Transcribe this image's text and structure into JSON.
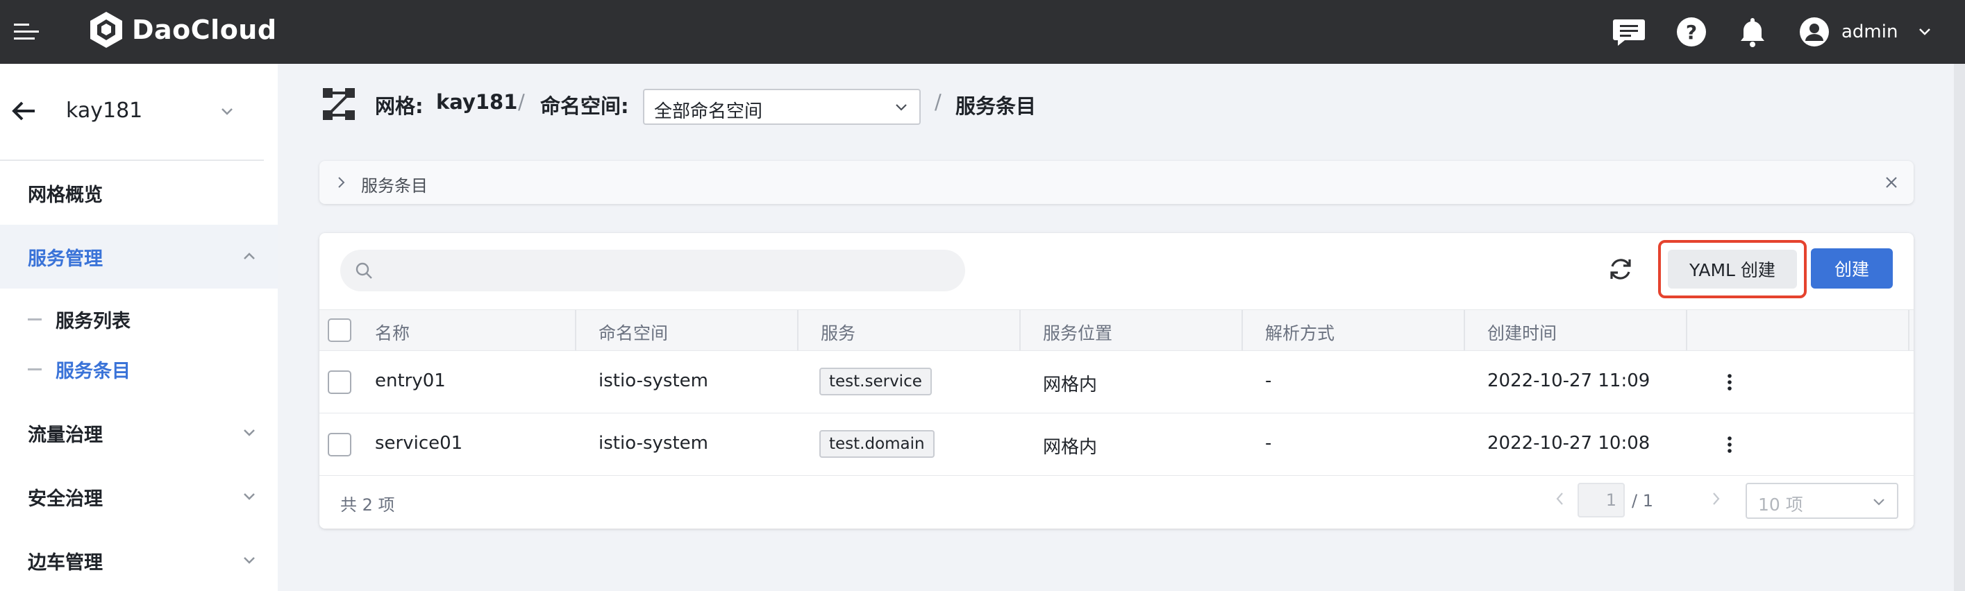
{
  "app": {
    "brand": "DaoCloud",
    "user": "admin",
    "colors": {
      "topbar": "#2f3033",
      "accent": "#3a73d8",
      "highlight": "#e5432e"
    }
  },
  "topbar_icons": [
    "menu-icon",
    "message-icon",
    "help-icon",
    "bell-icon",
    "user-avatar-icon"
  ],
  "sidebar": {
    "mesh_name": "kay181",
    "items": [
      {
        "label": "网格概览"
      },
      {
        "label": "服务管理",
        "expanded": true,
        "active": true
      },
      {
        "label": "流量治理"
      },
      {
        "label": "安全治理"
      },
      {
        "label": "边车管理"
      }
    ],
    "sub_items": [
      {
        "label": "服务列表"
      },
      {
        "label": "服务条目",
        "active": true
      }
    ]
  },
  "header": {
    "mesh_label": "网格:",
    "mesh_value": "kay181",
    "sep": "/",
    "namespace_label": "命名空间:",
    "namespace_value": "全部命名空间",
    "page_title": "服务条目"
  },
  "panel": {
    "label": "服务条目"
  },
  "toolbar": {
    "search_placeholder": "",
    "yaml_create": "YAML 创建",
    "create": "创建"
  },
  "table": {
    "columns": [
      "名称",
      "命名空间",
      "服务",
      "服务位置",
      "解析方式",
      "创建时间"
    ],
    "rows": [
      {
        "name": "entry01",
        "namespace": "istio-system",
        "service": "test.service",
        "location": "网格内",
        "resolution": "-",
        "created": "2022-10-27 11:09"
      },
      {
        "name": "service01",
        "namespace": "istio-system",
        "service": "test.domain",
        "location": "网格内",
        "resolution": "-",
        "created": "2022-10-27 10:08"
      }
    ]
  },
  "pagination": {
    "total": "共 2 项",
    "current_page": "1",
    "total_pages": "/ 1",
    "page_size": "10 项"
  }
}
